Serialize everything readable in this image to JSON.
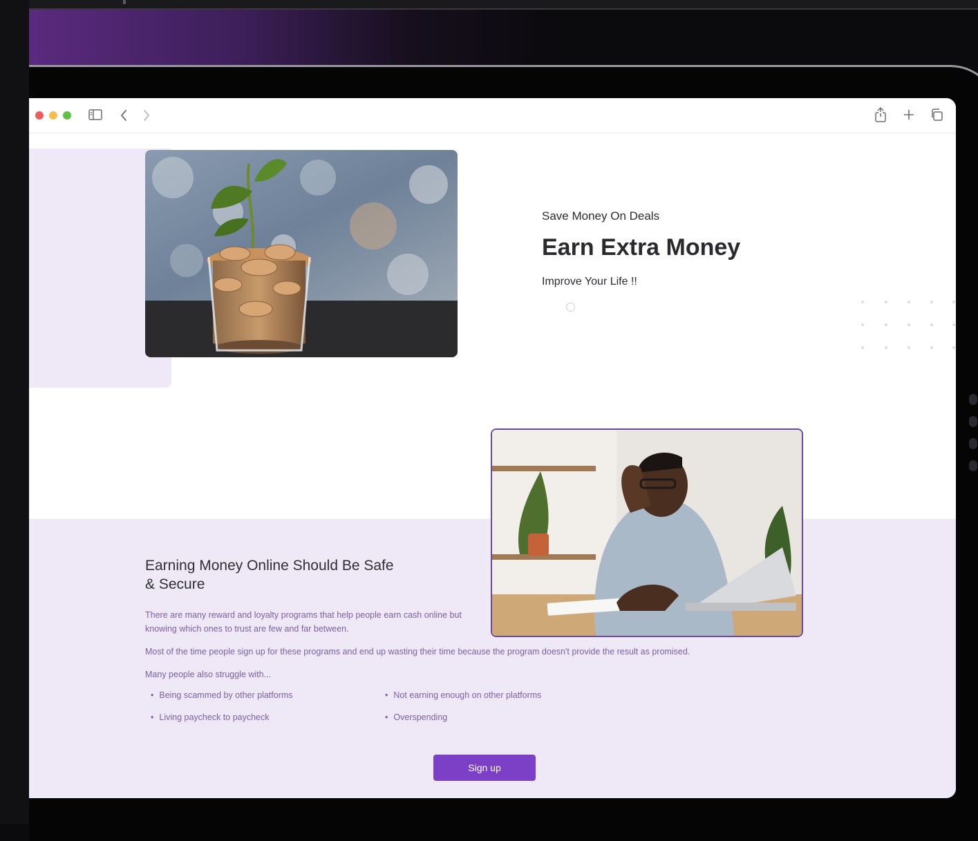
{
  "browser": {
    "traffic_lights": {
      "close": "#ec5f58",
      "minimize": "#f4bd4f",
      "maximize": "#5ec345"
    },
    "icons": [
      "sidebar-icon",
      "back-icon",
      "forward-icon",
      "share-icon",
      "new-tab-icon",
      "tabs-overview-icon"
    ]
  },
  "hero": {
    "eyebrow": "Save Money On Deals",
    "title": "Earn Extra Money",
    "subtitle": "Improve Your Life !!"
  },
  "section": {
    "title": "Earning Money Online Should Be Safe & Secure",
    "paragraph_1": "There are many reward and loyalty programs that help people earn cash online but knowing which ones to trust are few and far between.",
    "paragraph_2": "Most of the time people sign up for these programs and end up wasting their time because the program doesn't provide the result as promised.",
    "paragraph_3": "Many people also struggle with...",
    "bullets": [
      "Being scammed by other platforms",
      "Not earning enough on other platforms",
      "Living paycheck to paycheck",
      "Overspending"
    ],
    "cta": "Sign up"
  },
  "colors": {
    "accent": "#7b40c6",
    "lavender": "#efe9f7",
    "body_text": "#7a5ea8"
  }
}
